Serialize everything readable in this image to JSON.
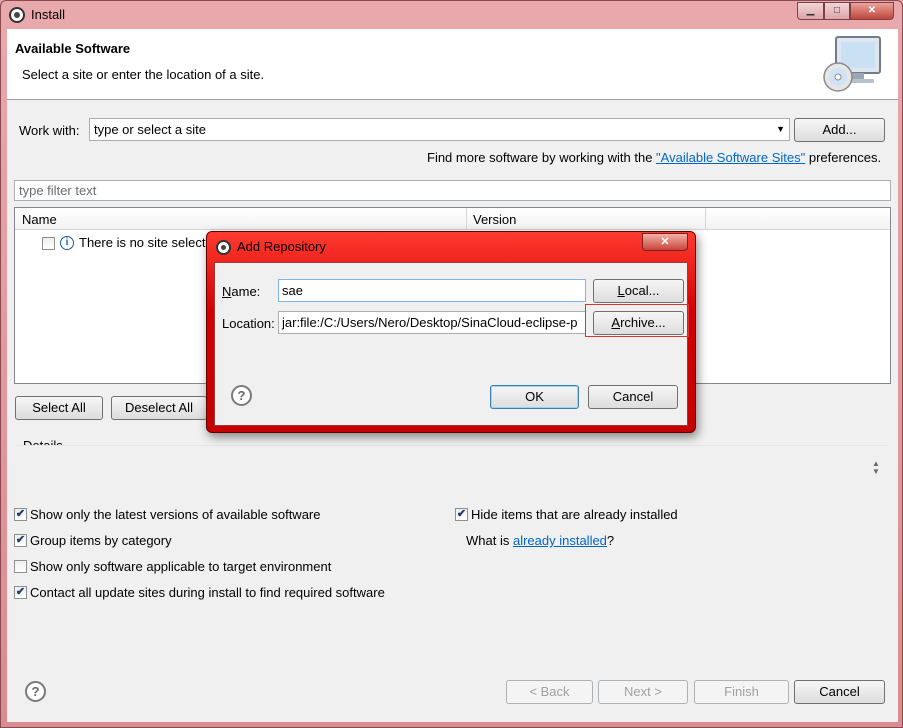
{
  "window": {
    "title": "Install",
    "min_glyph": "▁",
    "max_glyph": "□",
    "close_glyph": "✕"
  },
  "header": {
    "title": "Available Software",
    "subtitle": "Select a site or enter the location of a site."
  },
  "work_with": {
    "label": "Work with:",
    "value": "type or select a site",
    "add_label": "Add...",
    "find_more_prefix": "Find more software by working with the ",
    "find_more_link": "\"Available Software Sites\"",
    "find_more_suffix": " preferences."
  },
  "filter": {
    "placeholder": "type filter text"
  },
  "table": {
    "columns": [
      "Name",
      "Version"
    ],
    "message": "There is no site selected."
  },
  "buttons": {
    "select_all": "Select All",
    "deselect_all": "Deselect All"
  },
  "details": {
    "label": "Details"
  },
  "options": {
    "latest_versions": {
      "label": "Show only the latest versions of available software",
      "checked": true
    },
    "group_items": {
      "label": "Group items by category",
      "checked": true
    },
    "target_env": {
      "label": "Show only software applicable to target environment",
      "checked": false
    },
    "contact_sites": {
      "label": "Contact all update sites during install to find required software",
      "checked": true
    },
    "hide_installed": {
      "label": "Hide items that are already installed",
      "checked": true
    },
    "what_is_prefix": "What is ",
    "what_is_link": "already installed",
    "what_is_suffix": "?"
  },
  "footer": {
    "back": "< Back",
    "next": "Next >",
    "finish": "Finish",
    "cancel": "Cancel"
  },
  "dialog": {
    "title": "Add Repository",
    "close_glyph": "✕",
    "name_label_u": "N",
    "name_label_rest": "ame:",
    "name_value": "sae",
    "local_u": "L",
    "local_rest": "ocal...",
    "location_label": "Location:",
    "location_value": "jar:file:/C:/Users/Nero/Desktop/SinaCloud-eclipse-p",
    "archive_u": "A",
    "archive_rest": "rchive...",
    "ok": "OK",
    "cancel": "Cancel"
  },
  "icons": {
    "help": "?",
    "info": "i",
    "combo_arrow": "▼",
    "check": "✔"
  }
}
